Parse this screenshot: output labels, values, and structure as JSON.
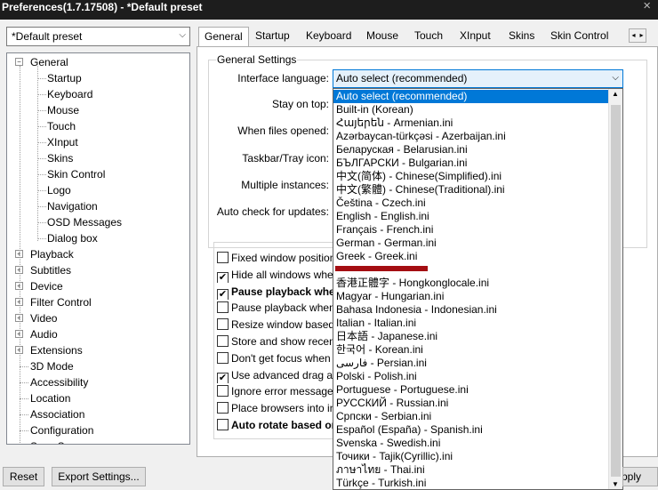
{
  "window": {
    "title": "Preferences(1.7.17508) - *Default preset",
    "close_icon": "×"
  },
  "preset_select": {
    "value": "*Default preset"
  },
  "tree": [
    {
      "label": "General",
      "level": 0,
      "expander": "−"
    },
    {
      "label": "Startup",
      "level": 1
    },
    {
      "label": "Keyboard",
      "level": 1
    },
    {
      "label": "Mouse",
      "level": 1
    },
    {
      "label": "Touch",
      "level": 1
    },
    {
      "label": "XInput",
      "level": 1
    },
    {
      "label": "Skins",
      "level": 1
    },
    {
      "label": "Skin Control",
      "level": 1
    },
    {
      "label": "Logo",
      "level": 1
    },
    {
      "label": "Navigation",
      "level": 1
    },
    {
      "label": "OSD Messages",
      "level": 1
    },
    {
      "label": "Dialog box",
      "level": 1
    },
    {
      "label": "Playback",
      "level": 0,
      "expander": "+"
    },
    {
      "label": "Subtitles",
      "level": 0,
      "expander": "+"
    },
    {
      "label": "Device",
      "level": 0,
      "expander": "+"
    },
    {
      "label": "Filter Control",
      "level": 0,
      "expander": "+"
    },
    {
      "label": "Video",
      "level": 0,
      "expander": "+"
    },
    {
      "label": "Audio",
      "level": 0,
      "expander": "+"
    },
    {
      "label": "Extensions",
      "level": 0,
      "expander": "+"
    },
    {
      "label": "3D Mode",
      "level": 0
    },
    {
      "label": "Accessibility",
      "level": 0
    },
    {
      "label": "Location",
      "level": 0
    },
    {
      "label": "Association",
      "level": 0
    },
    {
      "label": "Configuration",
      "level": 0
    },
    {
      "label": "Save S...",
      "level": 0
    }
  ],
  "tabs": [
    "General",
    "Startup",
    "Keyboard",
    "Mouse",
    "Touch",
    "XInput",
    "Skins",
    "Skin Control"
  ],
  "tab_scroll": {
    "left": "◂",
    "right": "▸"
  },
  "general": {
    "group_title": "General Settings",
    "interface_language_label": "Interface language:",
    "stay_on_top_label": "Stay on top:",
    "when_files_opened_label": "When files opened:",
    "taskbar_tray_label": "Taskbar/Tray icon:",
    "multiple_instances_label": "Multiple instances:",
    "auto_check_label": "Auto check for updates:"
  },
  "checkboxes": [
    {
      "label": "Fixed window position",
      "checked": false,
      "bold": false
    },
    {
      "label": "Hide all windows whe",
      "checked": true,
      "bold": false
    },
    {
      "label": "Pause playback when",
      "checked": true,
      "bold": true
    },
    {
      "label": "Pause playback when",
      "checked": false,
      "bold": false
    },
    {
      "label": "Resize window based",
      "checked": false,
      "bold": false
    },
    {
      "label": "Store and show recent",
      "checked": false,
      "bold": false
    },
    {
      "label": "Don't get focus when",
      "checked": false,
      "bold": false
    },
    {
      "label": "Use advanced drag an",
      "checked": true,
      "bold": false
    },
    {
      "label": "Ignore error messages",
      "checked": false,
      "bold": false
    },
    {
      "label": "Place browsers into in",
      "checked": false,
      "bold": false
    },
    {
      "label": "Auto rotate based on",
      "checked": false,
      "bold": true
    }
  ],
  "language": {
    "selected": "Auto select (recommended)",
    "options": [
      "Auto select (recommended)",
      "Built-in (Korean)",
      "Հայերեն - Armenian.ini",
      "Azərbaycan-türkçəsi - Azerbaijan.ini",
      "Беларуская - Belarusian.ini",
      "БЪЛГАРСКИ - Bulgarian.ini",
      "中文(简体) - Chinese(Simplified).ini",
      "中文(繁體) - Chinese(Traditional).ini",
      "Čeština - Czech.ini",
      "English - English.ini",
      "Français - French.ini",
      "German - German.ini",
      "Greek - Greek.ini",
      "",
      "香港正體字 - Hongkonglocale.ini",
      "Magyar - Hungarian.ini",
      "Bahasa Indonesia - Indonesian.ini",
      "Italian - Italian.ini",
      "日本語 - Japanese.ini",
      "한국어 - Korean.ini",
      "فارسی - Persian.ini",
      "Polski - Polish.ini",
      "Portuguese - Portuguese.ini",
      "РУССКИЙ - Russian.ini",
      "Српски - Serbian.ini",
      "Español (España) - Spanish.ini",
      "Svenska - Swedish.ini",
      "Точики - Tajik(Cyrillic).ini",
      "ภาษาไทย - Thai.ini",
      "Türkçe - Turkish.ini"
    ],
    "highlight_color": "#0078d7",
    "redaction_color": "#a40e12"
  },
  "buttons": {
    "reset": "Reset",
    "export": "Export Settings...",
    "apply": "Apply"
  },
  "colors": {
    "titlebar": "#1d1d1d",
    "accent": "#0078d7"
  }
}
